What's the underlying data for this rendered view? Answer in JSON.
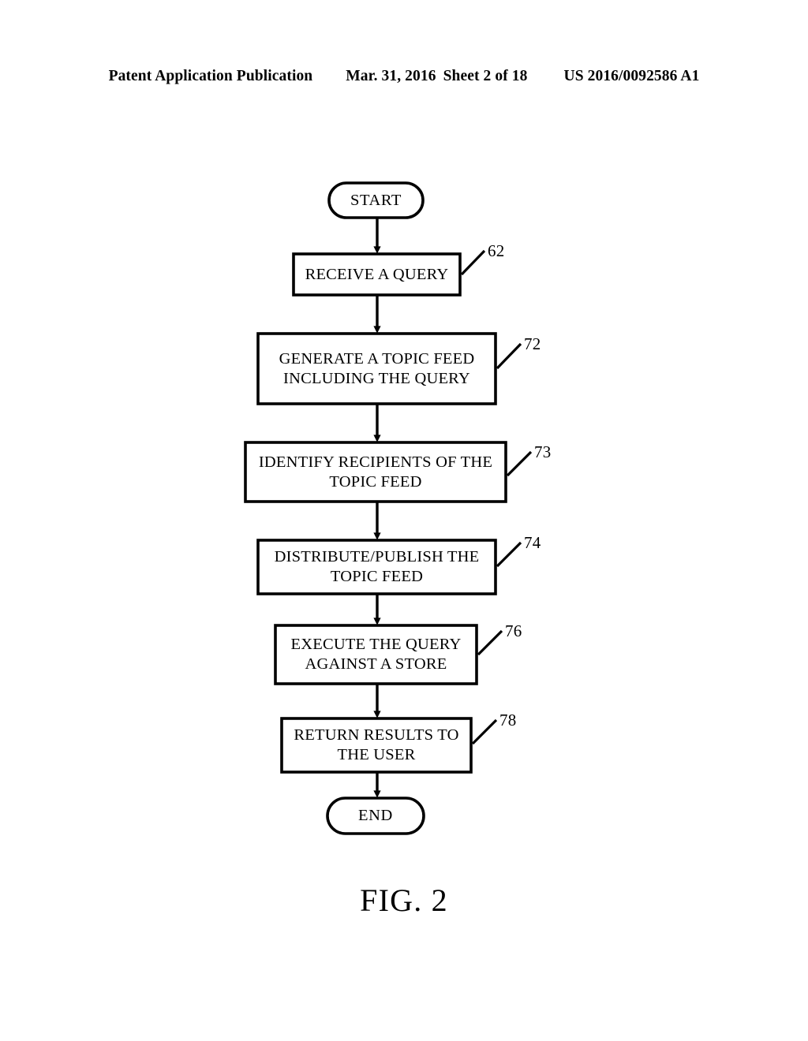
{
  "header": {
    "publication": "Patent Application Publication",
    "date": "Mar. 31, 2016",
    "sheet": "Sheet 2 of 18",
    "number": "US 2016/0092586 A1"
  },
  "figure": {
    "caption": "FIG. 2",
    "line_color": "#000000",
    "fill_color": "#ffffff",
    "nodes": [
      {
        "id": "start",
        "shape": "terminator",
        "label": "START",
        "ref": null
      },
      {
        "id": "step62",
        "shape": "process",
        "label": "RECEIVE A QUERY",
        "ref": "62"
      },
      {
        "id": "step72",
        "shape": "process",
        "label": "GENERATE A TOPIC FEED\nINCLUDING THE QUERY",
        "ref": "72"
      },
      {
        "id": "step73",
        "shape": "process",
        "label": "IDENTIFY RECIPIENTS OF THE\nTOPIC FEED",
        "ref": "73"
      },
      {
        "id": "step74",
        "shape": "process",
        "label": "DISTRIBUTE/PUBLISH THE\nTOPIC FEED",
        "ref": "74"
      },
      {
        "id": "step76",
        "shape": "process",
        "label": "EXECUTE THE QUERY\nAGAINST A STORE",
        "ref": "76"
      },
      {
        "id": "step78",
        "shape": "process",
        "label": "RETURN RESULTS TO\nTHE USER",
        "ref": "78"
      },
      {
        "id": "end",
        "shape": "terminator",
        "label": "END",
        "ref": null
      }
    ]
  }
}
